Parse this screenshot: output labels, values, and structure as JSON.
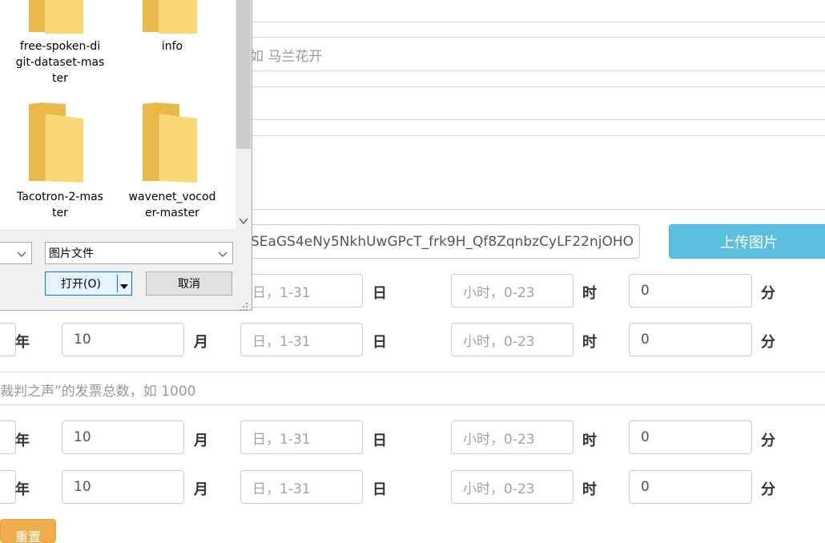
{
  "form": {
    "name_placeholder_partial": "如 马兰花开",
    "image_url_value": "SEaGS4eNy5NkhUwGPcT_frk9H_Qf8ZqnbzCyLF22njOHO",
    "upload_button": "上传图片",
    "vote_total_placeholder_partial": "裁判之声”的发票总数，如 1000",
    "reset_button": "重置",
    "units": {
      "year": "年",
      "month": "月",
      "day": "日",
      "hour": "时",
      "minute": "分"
    },
    "day_placeholder": "日，1-31",
    "hour_placeholder": "小时，0-23",
    "rows": [
      {
        "month": "",
        "minute": "0"
      },
      {
        "month": "10",
        "minute": "0"
      },
      {
        "month": "10",
        "minute": "0"
      },
      {
        "month": "10",
        "minute": "0"
      }
    ]
  },
  "dialog": {
    "folders": [
      {
        "name": "free-spoken-digit-dataset-master",
        "lines": [
          "free-spoken-di",
          "git-dataset-mas",
          "ter"
        ]
      },
      {
        "name": "info",
        "lines": [
          "info"
        ]
      },
      {
        "name": "Tacotron-2-master",
        "lines": [
          "Tacotron-2-mas",
          "ter"
        ]
      },
      {
        "name": "wavenet_vocoder-master",
        "lines": [
          "wavenet_vocod",
          "er-master"
        ]
      }
    ],
    "file_type": "图片文件",
    "open_button": "打开(O)",
    "cancel_button": "取消"
  },
  "colors": {
    "upload": "#5bc0de",
    "reset": "#f0ad4e",
    "folder": "#f8d775"
  }
}
